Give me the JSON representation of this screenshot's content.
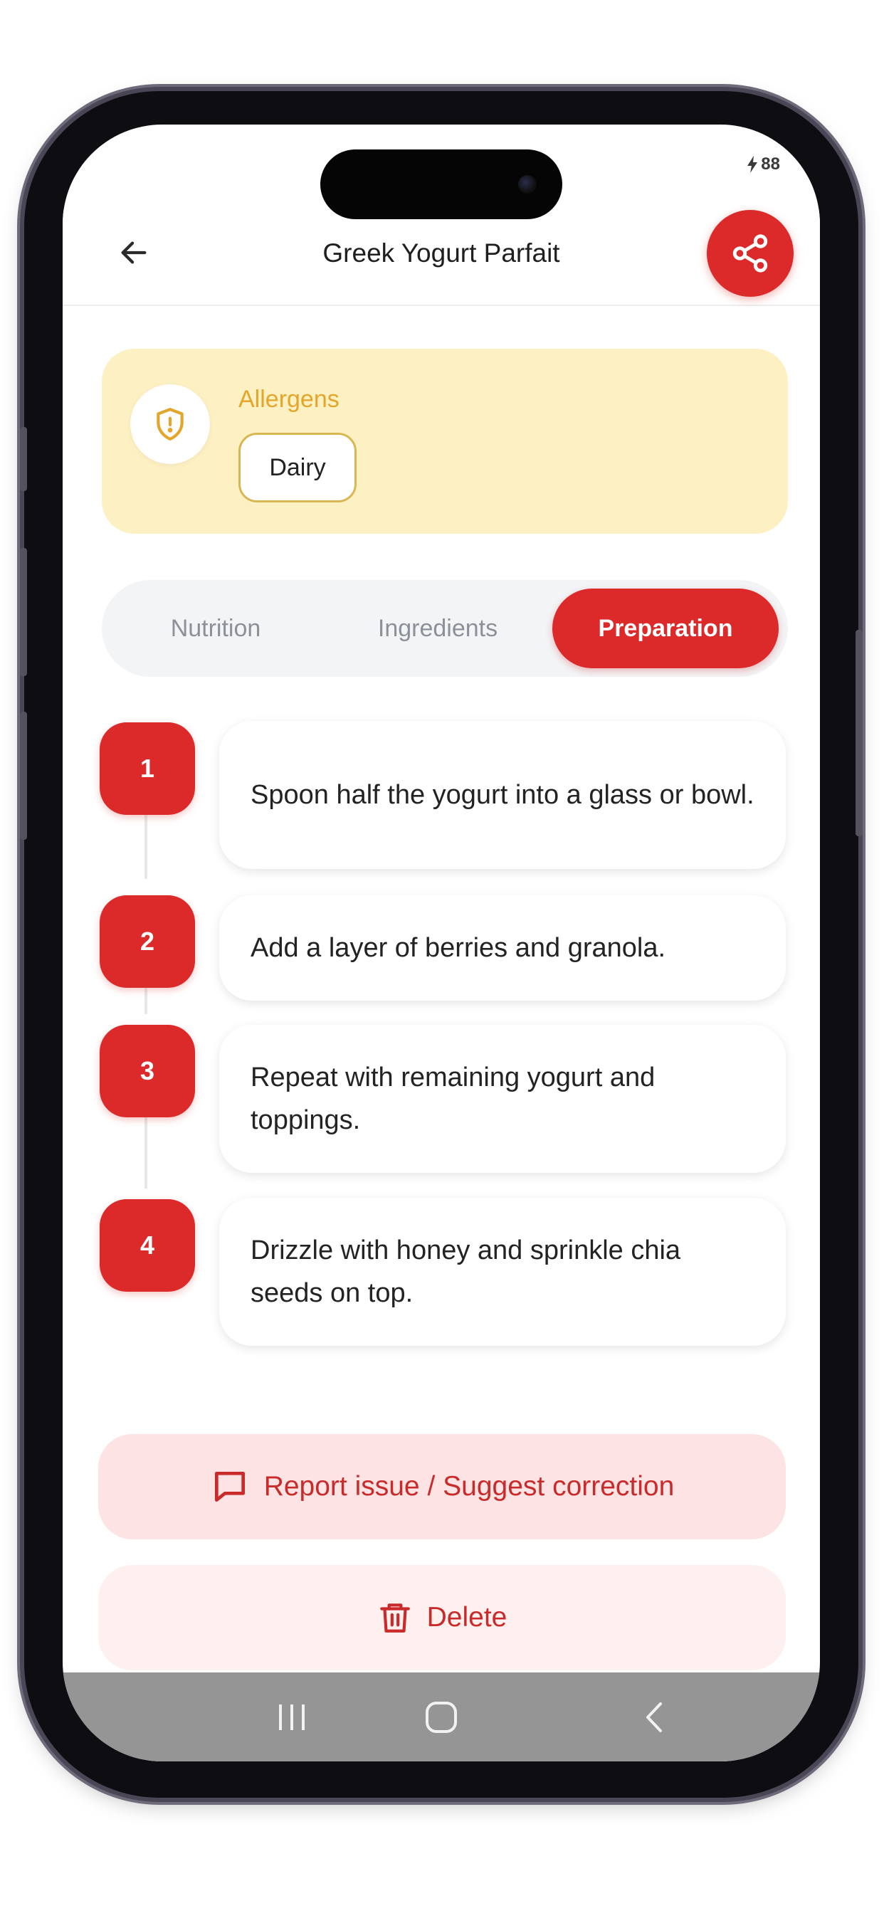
{
  "status_bar": {
    "battery": "88"
  },
  "header": {
    "title": "Greek Yogurt Parfait"
  },
  "allergens": {
    "title": "Allergens",
    "items": [
      "Dairy"
    ]
  },
  "tabs": [
    {
      "label": "Nutrition",
      "active": false
    },
    {
      "label": "Ingredients",
      "active": false
    },
    {
      "label": "Preparation",
      "active": true
    }
  ],
  "steps": [
    {
      "number": "1",
      "text": "Spoon half the yogurt into a glass or bowl."
    },
    {
      "number": "2",
      "text": "Add a layer of berries and granola."
    },
    {
      "number": "3",
      "text": "Repeat with remaining yogurt and toppings."
    },
    {
      "number": "4",
      "text": "Drizzle with honey and sprinkle chia seeds on top."
    }
  ],
  "actions": {
    "report_label": "Report issue / Suggest correction",
    "delete_label": "Delete"
  },
  "colors": {
    "accent": "#dc2a2a",
    "allergen_bg": "#fdf1c4",
    "allergen_text": "#e3a52a",
    "report_bg": "#fde3e3",
    "delete_bg": "#fdf0ef",
    "navbar_bg": "#959595"
  },
  "icons": {
    "back": "arrow-left-icon",
    "share": "share-icon",
    "allergen": "shield-alert-icon",
    "report": "message-square-icon",
    "delete": "trash-icon",
    "nav_recents": "recents-icon",
    "nav_home": "home-icon",
    "nav_back": "chevron-left-icon"
  }
}
